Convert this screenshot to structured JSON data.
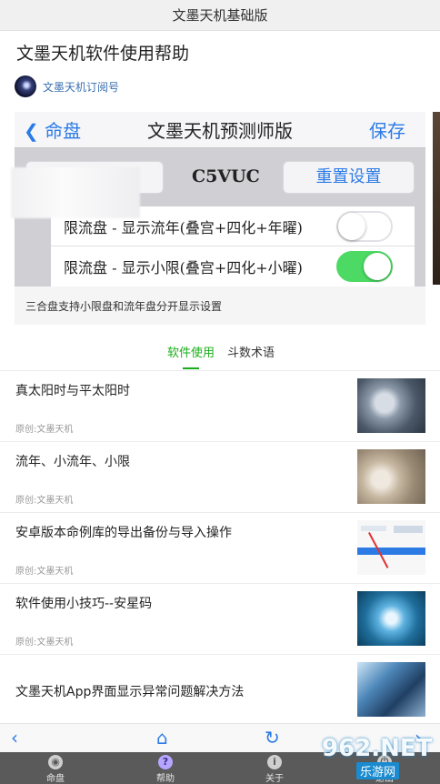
{
  "topbar": {
    "title": "文墨天机基础版"
  },
  "article": {
    "title": "文墨天机软件使用帮助",
    "author": "文墨天机订阅号"
  },
  "banner": {
    "nav_back": "命盘",
    "nav_title": "文墨天机预测师版",
    "nav_save": "保存",
    "code": "C5VUC",
    "reset_label": "重置设置",
    "rows": [
      {
        "label": "限流盘 - 显示流年(叠宫+四化+年曜)",
        "toggle": "off"
      },
      {
        "label": "限流盘 - 显示小限(叠宫+四化+小曜)",
        "toggle": "on"
      }
    ],
    "caption": "三合盘支持小限盘和流年盘分开显示设置"
  },
  "tabs": [
    {
      "label": "软件使用",
      "active": true
    },
    {
      "label": "斗数术语",
      "active": false
    }
  ],
  "articles": [
    {
      "title": "真太阳时与平太阳时",
      "source": "原创:文墨天机",
      "thumb": "pocket-watch-image"
    },
    {
      "title": "流年、小流年、小限",
      "source": "原创:文墨天机",
      "thumb": "watch-on-sand-image"
    },
    {
      "title": "安卓版本命例库的导出备份与导入操作",
      "source": "原创:文墨天机",
      "thumb": "app-screenshot-image"
    },
    {
      "title": "软件使用小技巧--安星码",
      "source": "原创:文墨天机",
      "thumb": "gears-image"
    },
    {
      "title": "文墨天机App界面显示异常问题解决方法",
      "source": "",
      "thumb": "phones-image"
    }
  ],
  "browser_bar": {
    "back": "‹",
    "home": "⌂",
    "refresh": "↻",
    "forward": "›"
  },
  "bottom_nav": [
    {
      "label": "命盘",
      "icon": "chart-icon",
      "glyph": "◉"
    },
    {
      "label": "帮助",
      "icon": "help-icon",
      "glyph": "?"
    },
    {
      "label": "关于",
      "icon": "info-icon",
      "glyph": "i"
    },
    {
      "label": "退出",
      "icon": "exit-icon",
      "glyph": "⏻"
    }
  ],
  "watermark": {
    "text": "962.NET",
    "sub": "乐游网"
  },
  "colors": {
    "accent_green": "#1aad19",
    "link_blue": "#2c7be5",
    "toggle_on": "#4cd964",
    "nav_bg": "#5a5a5a"
  }
}
